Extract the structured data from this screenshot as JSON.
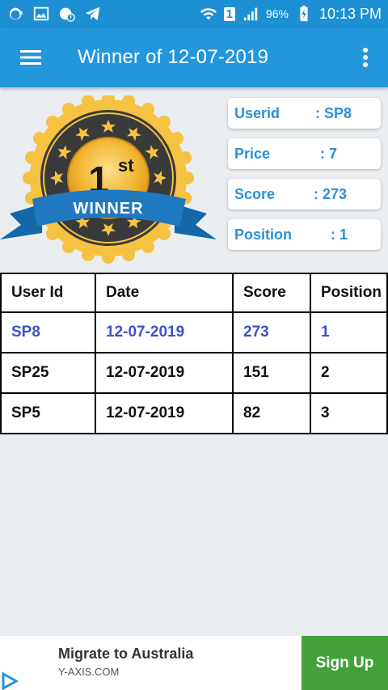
{
  "status": {
    "battery": "96%",
    "time": "10:13 PM",
    "sim": "1"
  },
  "appbar": {
    "title": "Winner of 12-07-2019"
  },
  "badge": {
    "rank_num": "1",
    "rank_suffix": "st",
    "ribbon": "WINNER"
  },
  "info": {
    "userid_label": "Userid",
    "userid_value": ": SP8",
    "price_label": "Price",
    "price_value": ": 7",
    "score_label": "Score",
    "score_value": ": 273",
    "position_label": "Position",
    "position_value": ": 1"
  },
  "table": {
    "headers": [
      "User Id",
      "Date",
      "Score",
      "Position"
    ],
    "rows": [
      [
        "SP8",
        "12-07-2019",
        "273",
        "1"
      ],
      [
        "SP25",
        "12-07-2019",
        "151",
        "2"
      ],
      [
        "SP5",
        "12-07-2019",
        "82",
        "3"
      ]
    ]
  },
  "ad": {
    "title": "Migrate to Australia",
    "subtitle": "Y-AXIS.COM",
    "button": "Sign Up"
  },
  "colors": {
    "appbar": "#2496db",
    "statusbar": "#1d8fd3",
    "label_blue": "#2b90d9",
    "highlight_row": "#3d52c7",
    "ad_button": "#43a13a"
  }
}
